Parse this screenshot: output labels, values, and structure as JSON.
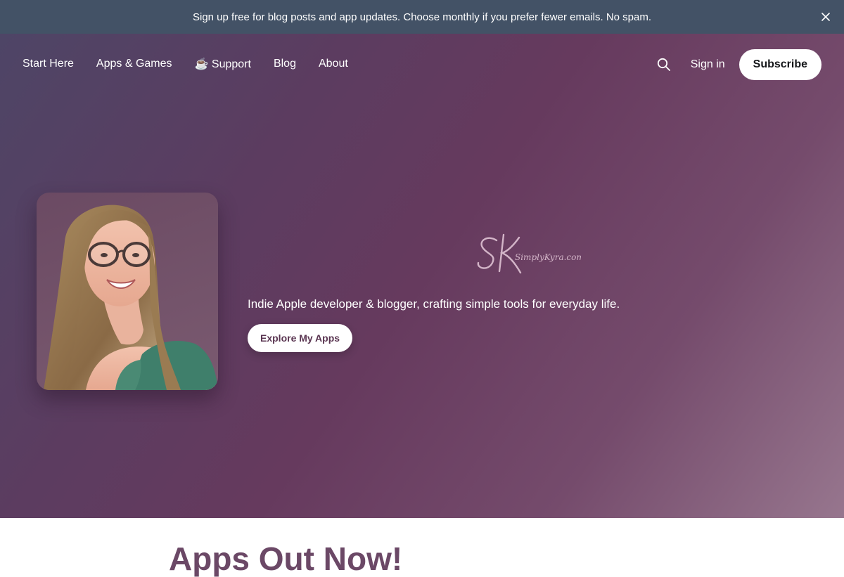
{
  "banner": {
    "text": "Sign up free for blog posts and app updates. Choose monthly if you prefer fewer emails. No spam.",
    "close_icon": "close-icon"
  },
  "nav": {
    "items": [
      {
        "label": "Start Here"
      },
      {
        "label": "Apps & Games"
      },
      {
        "label": "☕ Support"
      },
      {
        "label": "Blog"
      },
      {
        "label": "About"
      }
    ],
    "search_icon": "search-icon",
    "signin_label": "Sign in",
    "subscribe_label": "Subscribe"
  },
  "hero": {
    "logo_text": "SK SimplyKyra.com",
    "tagline": "Indie Apple developer & blogger, crafting simple tools for everyday life.",
    "cta_label": "Explore My Apps"
  },
  "section": {
    "heading": "Apps Out Now!"
  },
  "colors": {
    "banner_bg": "#435266",
    "hero_mid": "#663a5e",
    "accent_text": "#6b4866"
  }
}
